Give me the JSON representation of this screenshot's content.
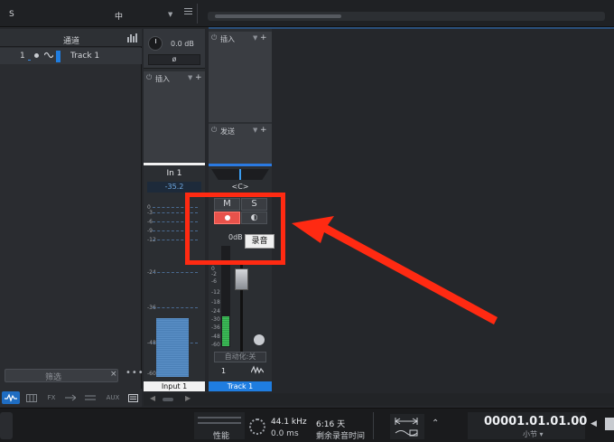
{
  "topbar": {
    "left_label": "S",
    "zoom_label": "中",
    "dropdown_glyph": "▼"
  },
  "channel_list": {
    "title": "通道",
    "rows": [
      {
        "number": "1",
        "name": "Track 1"
      }
    ],
    "filter_placeholder": "筛选",
    "filter_clear": "×",
    "more": "•••",
    "tabs": [
      "FX",
      "AUX"
    ]
  },
  "input_strip": {
    "gain_value": "0.0 dB",
    "phase_label": "ø",
    "insert_title": "插入",
    "name": "In 1",
    "level": "-35.2",
    "scale": [
      "0",
      "-3",
      "-6",
      "-9",
      "-12",
      "-24",
      "-36",
      "-48",
      "-60"
    ],
    "footer": "Input 1"
  },
  "track_strip": {
    "insert_title": "插入",
    "send_title": "发送",
    "pan_label": "<C>",
    "mute_label": "M",
    "solo_label": "S",
    "monitor_label": "◐",
    "volume_value": "0dB",
    "tooltip": "录音",
    "scale": [
      "0",
      "-2",
      "-6",
      "-12",
      "-18",
      "-24",
      "-30",
      "-36",
      "-48",
      "-60"
    ],
    "automation_label": "自动化:关",
    "channel_number": "1",
    "footer": "Track 1"
  },
  "transport": {
    "performance_label": "性能",
    "sample_rate": "44.1 kHz",
    "latency": "0.0 ms",
    "remaining_days": "6:16 天",
    "remaining_label": "剩余录音时间",
    "position": "00001.01.01.00",
    "position_unit": "小节 ▾"
  },
  "colors": {
    "accent_blue": "#1f7de0",
    "record_red": "#e8524b",
    "annotation_red": "#ff2a12",
    "meter_green": "#3fbf5a",
    "meter_blue": "#5a8fc6"
  }
}
